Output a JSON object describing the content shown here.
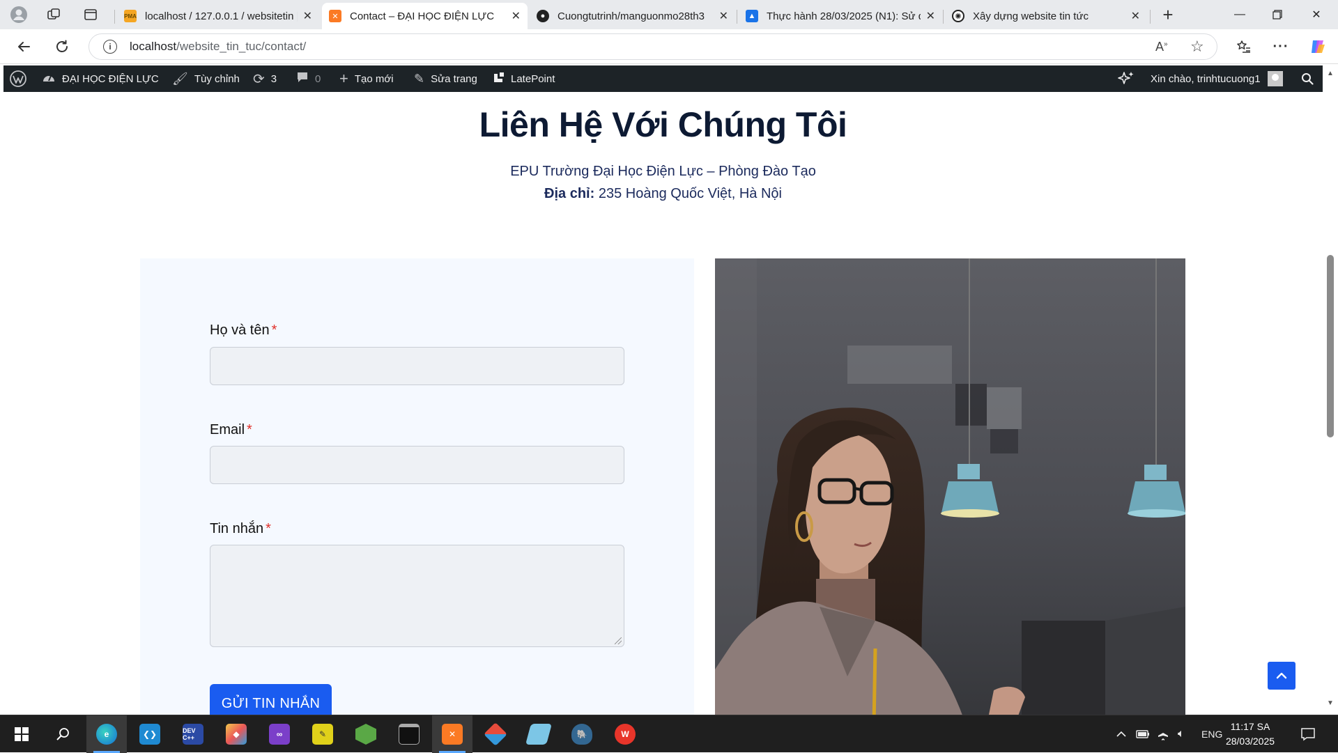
{
  "browser": {
    "tabs": [
      {
        "title": "localhost / 127.0.0.1 / websitetin |",
        "icon": "phpmyadmin-icon",
        "active": false
      },
      {
        "title": "Contact – ĐẠI HỌC ĐIỆN LỰC",
        "icon": "xampp-icon",
        "active": true
      },
      {
        "title": "Cuongtutrinh/manguonmo28th3",
        "icon": "github-icon",
        "active": false
      },
      {
        "title": "Thực hành 28/03/2025 (N1): Sử dụ",
        "icon": "classroom-icon",
        "active": false
      },
      {
        "title": "Xây dựng website tin tức",
        "icon": "chatgpt-icon",
        "active": false
      }
    ],
    "url_host": "localhost",
    "url_path": "/website_tin_tuc/contact/"
  },
  "adminbar": {
    "site_name": "ĐẠI HỌC ĐIỆN LỰC",
    "customize": "Tùy chỉnh",
    "updates_count": "3",
    "comments_count": "0",
    "new": "Tạo mới",
    "edit_page": "Sửa trang",
    "latepoint": "LatePoint",
    "greeting": "Xin chào, trinhtucuong1"
  },
  "page": {
    "title": "Liên Hệ Với Chúng Tôi",
    "subtitle": "EPU Trường Đại Học Điện Lực – Phòng Đào Tạo",
    "address_label": "Địa chỉ:",
    "address": "235 Hoàng Quốc Việt, Hà Nội"
  },
  "form": {
    "name_label": "Họ và tên",
    "email_label": "Email",
    "message_label": "Tin nhắn",
    "required_mark": "*",
    "submit_label": "GỬI TIN NHẮN"
  },
  "taskbar": {
    "language": "ENG",
    "time": "11:17 SA",
    "date": "28/03/2025"
  },
  "colors": {
    "accent": "#1a5cf0",
    "adminbar": "#1d2327",
    "heading": "#0d1a33",
    "form_bg": "#f5f9ff"
  }
}
